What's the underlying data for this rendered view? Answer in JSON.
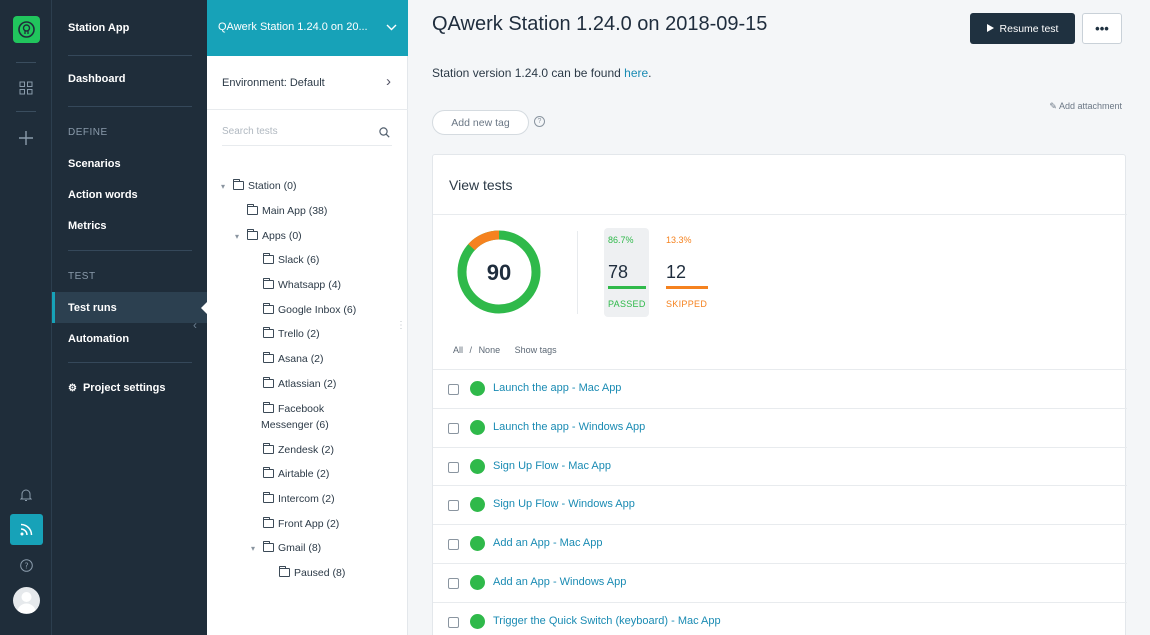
{
  "app": {
    "name": "Station App"
  },
  "nav": {
    "dashboard": "Dashboard",
    "define_section": "DEFINE",
    "scenarios": "Scenarios",
    "action_words": "Action words",
    "metrics": "Metrics",
    "test_section": "TEST",
    "test_runs": "Test runs",
    "automation": "Automation",
    "project_settings": "Project settings"
  },
  "tree_panel": {
    "header_title": "QAwerk Station 1.24.0 on 20...",
    "environment": "Environment: Default",
    "search_placeholder": "Search tests",
    "nodes": [
      {
        "label": "Station (0)"
      },
      {
        "label": "Main App (38)"
      },
      {
        "label": "Apps (0)"
      },
      {
        "label": "Slack (6)"
      },
      {
        "label": "Whatsapp (4)"
      },
      {
        "label": "Google Inbox (6)"
      },
      {
        "label": "Trello (2)"
      },
      {
        "label": "Asana (2)"
      },
      {
        "label": "Atlassian (2)"
      },
      {
        "label": "Facebook",
        "label2": "Messenger (6)"
      },
      {
        "label": "Zendesk (2)"
      },
      {
        "label": "Airtable (2)"
      },
      {
        "label": "Intercom (2)"
      },
      {
        "label": "Front App (2)"
      },
      {
        "label": "Gmail (8)"
      },
      {
        "label": "Paused (8)"
      }
    ]
  },
  "main": {
    "title": "QAwerk Station 1.24.0 on 2018-09-15",
    "resume_label": "Resume test",
    "more_label": "•••",
    "version_text": "Station version 1.24.0 can be found ",
    "version_link": "here",
    "version_end": ".",
    "add_attachment": "Add attachment",
    "add_tag": "Add new tag",
    "card": {
      "title": "View tests",
      "total": "90",
      "passed": {
        "pct": "86.7%",
        "count": "78",
        "label": "PASSED",
        "color": "#2fb94a"
      },
      "skipped": {
        "pct": "13.3%",
        "count": "12",
        "label": "SKIPPED",
        "color": "#f5821f"
      },
      "donut_fraction_passed": 0.867,
      "filter_all": "All",
      "filter_sep": "/",
      "filter_none": "None",
      "show_tags": "Show tags",
      "tests": [
        {
          "name": "Launch the app - Mac App"
        },
        {
          "name": "Launch the app - Windows App"
        },
        {
          "name": "Sign Up Flow - Mac App"
        },
        {
          "name": "Sign Up Flow - Windows App"
        },
        {
          "name": "Add an App - Mac App"
        },
        {
          "name": "Add an App - Windows App"
        },
        {
          "name": "Trigger the Quick Switch (keyboard) - Mac App"
        }
      ]
    }
  },
  "colors": {
    "accent": "#17a2b8",
    "sidebar": "#1f2d3a",
    "passed": "#2fb94a",
    "skipped": "#f5821f",
    "link": "#1a8bb3"
  }
}
